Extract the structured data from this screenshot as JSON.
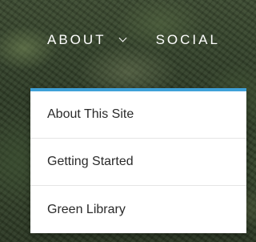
{
  "nav": {
    "items": [
      {
        "label": "ABOUT",
        "has_dropdown": true,
        "icon": "chevron-down-icon"
      },
      {
        "label": "SOCIAL"
      }
    ]
  },
  "dropdown": {
    "accent_color": "#3fa1d8",
    "items": [
      {
        "label": "About This Site"
      },
      {
        "label": "Getting Started"
      },
      {
        "label": "Green Library"
      }
    ]
  }
}
